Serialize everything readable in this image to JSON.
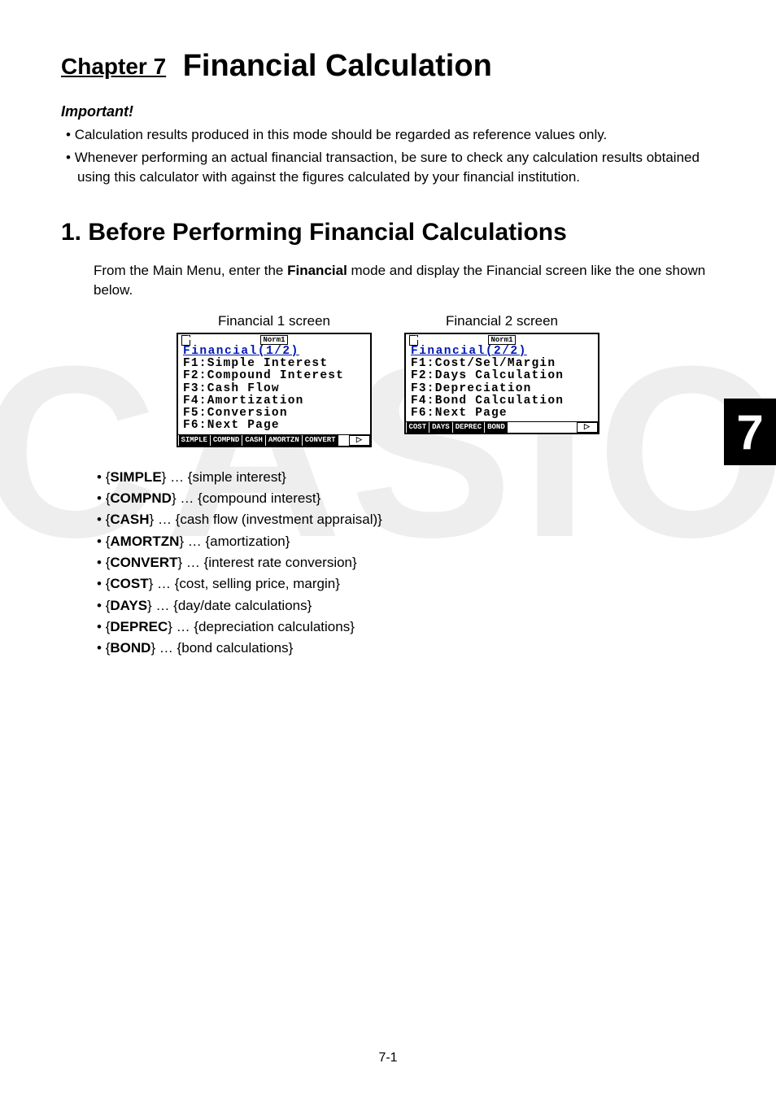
{
  "watermark": "CASIO",
  "chapter": {
    "prefix": "Chapter 7",
    "title": "Financial Calculation"
  },
  "important_label": "Important!",
  "important_bullets": [
    "Calculation results produced in this mode should be regarded as reference values only.",
    "Whenever performing an actual financial transaction, be sure to check any calculation results obtained using this calculator with against the figures calculated by your financial institution."
  ],
  "section_title": "1. Before Performing Financial Calculations",
  "intro": {
    "pre": "From the Main Menu, enter the ",
    "bold": "Financial",
    "post": " mode and display the Financial screen like the one shown below."
  },
  "screens": [
    {
      "caption": "Financial 1 screen",
      "badge": "Norm1",
      "title": "Financial(1/2)",
      "lines": [
        "F1:Simple Interest",
        "F2:Compound Interest",
        "F3:Cash Flow",
        "F4:Amortization",
        "F5:Conversion",
        "F6:Next Page"
      ],
      "softkeys": [
        "SIMPLE",
        "COMPND",
        "CASH",
        "AMORTZN",
        "CONVERT"
      ],
      "arrow": "▷"
    },
    {
      "caption": "Financial 2 screen",
      "badge": "Norm1",
      "title": "Financial(2/2)",
      "lines": [
        "F1:Cost/Sel/Margin",
        "F2:Days Calculation",
        "F3:Depreciation",
        "F4:Bond Calculation",
        "",
        "F6:Next Page"
      ],
      "softkeys": [
        "COST",
        "DAYS",
        "DEPREC",
        "BOND"
      ],
      "arrow": "▷"
    }
  ],
  "functions": [
    {
      "key": "SIMPLE",
      "desc": "simple interest"
    },
    {
      "key": "COMPND",
      "desc": "compound interest"
    },
    {
      "key": "CASH",
      "desc": "cash flow (investment appraisal)"
    },
    {
      "key": "AMORTZN",
      "desc": "amortization"
    },
    {
      "key": "CONVERT",
      "desc": "interest rate conversion"
    },
    {
      "key": "COST",
      "desc": "cost, selling price, margin"
    },
    {
      "key": "DAYS",
      "desc": "day/date calculations"
    },
    {
      "key": "DEPREC",
      "desc": "depreciation calculations"
    },
    {
      "key": "BOND",
      "desc": "bond calculations"
    }
  ],
  "tab": "7",
  "page_number": "7-1"
}
